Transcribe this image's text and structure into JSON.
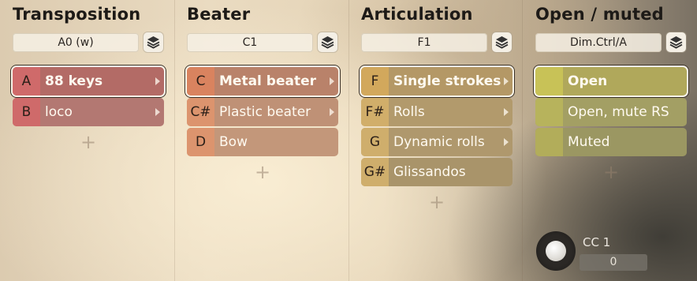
{
  "columns": [
    {
      "title": "Transposition",
      "selector": "A0 (w)",
      "rows": [
        {
          "key": "A",
          "label": "88 keys",
          "has_arrow": true,
          "selected": true
        },
        {
          "key": "B",
          "label": "loco",
          "has_arrow": true,
          "selected": false
        }
      ]
    },
    {
      "title": "Beater",
      "selector": "C1",
      "rows": [
        {
          "key": "C",
          "label": "Metal beater",
          "has_arrow": true,
          "selected": true
        },
        {
          "key": "C#",
          "label": "Plastic beater",
          "has_arrow": true,
          "selected": false
        },
        {
          "key": "D",
          "label": "Bow",
          "has_arrow": false,
          "selected": false
        }
      ]
    },
    {
      "title": "Articulation",
      "selector": "F1",
      "rows": [
        {
          "key": "F",
          "label": "Single strokes",
          "has_arrow": true,
          "selected": true
        },
        {
          "key": "F#",
          "label": "Rolls",
          "has_arrow": true,
          "selected": false
        },
        {
          "key": "G",
          "label": "Dynamic rolls",
          "has_arrow": true,
          "selected": false
        },
        {
          "key": "G#",
          "label": "Glissandos",
          "has_arrow": false,
          "selected": false
        }
      ]
    },
    {
      "title": "Open / muted",
      "selector": "Dim.Ctrl/A",
      "rows": [
        {
          "key": "",
          "label": "Open",
          "has_arrow": false,
          "selected": true
        },
        {
          "key": "",
          "label": "Open, mute RS",
          "has_arrow": false,
          "selected": false
        },
        {
          "key": "",
          "label": "Muted",
          "has_arrow": false,
          "selected": false
        }
      ]
    }
  ],
  "add_symbol": "+",
  "cc": {
    "label": "CC 1",
    "value": "0"
  },
  "icons": {
    "layers": "layers-icon",
    "arrow": "chevron-right-icon",
    "add": "plus-icon"
  },
  "colors": {
    "transposition_row": "#b36b66",
    "transposition_key": "#cf6a6a",
    "beater_row": "#b9826a",
    "beater_key": "#d9835f",
    "articulation_row": "#b49866",
    "articulation_key": "#d2a85c",
    "open_row": "#b0a85b",
    "open_key": "#c8c257"
  }
}
